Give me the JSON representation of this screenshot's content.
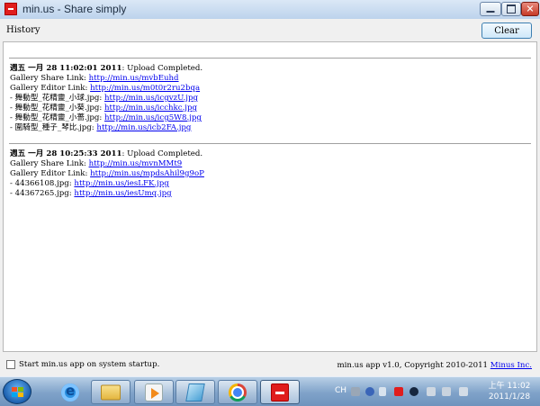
{
  "window": {
    "title": "min.us - Share simply",
    "controls": {
      "minimize": "–",
      "maximize": "□",
      "close": "✕"
    }
  },
  "toolbar": {
    "history_label": "History",
    "clear_label": "Clear"
  },
  "log": {
    "entries": [
      {
        "date": "週五 一月 28 11:02:01 2011",
        "status": ": Upload Completed.",
        "share_label": "Gallery Share Link: ",
        "share_url": "http://min.us/mvbEuhd",
        "editor_label": "Gallery Editor Link: ",
        "editor_url": "http://min.us/m0t0r2ru2bqa",
        "files": [
          {
            "name": "- 舞動型_花精靈_小球.jpg: ",
            "url": "http://min.us/icgvzU.jpg"
          },
          {
            "name": "- 舞動型_花精靈_小葵.jpg: ",
            "url": "http://min.us/icchkc.jpg"
          },
          {
            "name": "- 舞動型_花精靈_小薔.jpg: ",
            "url": "http://min.us/icg5W8.jpg"
          },
          {
            "name": "- 圍騎型_種子_琴比.jpg: ",
            "url": "http://min.us/icb2FA.jpg"
          }
        ]
      },
      {
        "date": "週五 一月 28 10:25:33 2011",
        "status": ": Upload Completed.",
        "share_label": "Gallery Share Link: ",
        "share_url": "http://min.us/mvnMMt9",
        "editor_label": "Gallery Editor Link: ",
        "editor_url": "http://min.us/mpdsAhil9g9oP",
        "files": [
          {
            "name": "- 44366108.jpg: ",
            "url": "http://min.us/iesLFK.jpg"
          },
          {
            "name": "- 44367265.jpg: ",
            "url": "http://min.us/iesUmq.jpg"
          }
        ]
      }
    ]
  },
  "footer": {
    "startup_label": "Start min.us app on system startup.",
    "startup_checked": false,
    "copyright": "min.us app v1.0, Copyright 2010-2011 ",
    "company_link": "Minus Inc."
  },
  "taskbar": {
    "items": [
      {
        "icon": "internet-explorer-icon"
      },
      {
        "icon": "folder-icon"
      },
      {
        "icon": "media-player-icon"
      },
      {
        "icon": "notepad-icon"
      },
      {
        "icon": "chrome-icon"
      },
      {
        "icon": "minus-app-icon"
      }
    ],
    "tray_language": "CH",
    "clock_time": "上午 11:02",
    "clock_date": "2011/1/28"
  },
  "colors": {
    "link": "#0000ee",
    "brand_red": "#e01d1d"
  }
}
